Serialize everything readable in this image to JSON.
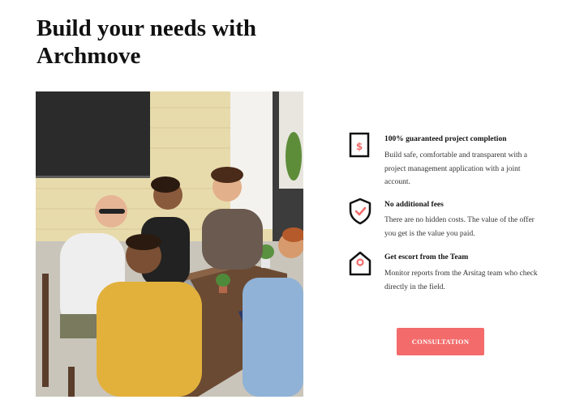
{
  "hero": {
    "heading": "Build your needs with Archmove"
  },
  "photo": {
    "description_icon": "team-meeting-photo"
  },
  "features": [
    {
      "icon": "dollar-document-icon",
      "title": "100% guaranteed project completion",
      "description": "Build safe, comfortable and transparent with a project management application with a joint account."
    },
    {
      "icon": "shield-check-icon",
      "title": "No additional fees",
      "description": "There are no hidden costs. The value of the offer you get is the value you paid."
    },
    {
      "icon": "house-tag-icon",
      "title": "Get escort from the Team",
      "description": "Monitor reports from the Arsitag team who check directly in the field."
    }
  ],
  "cta": {
    "label": "CONSULTATION"
  },
  "colors": {
    "accent": "#f36b6b",
    "text": "#111111"
  }
}
